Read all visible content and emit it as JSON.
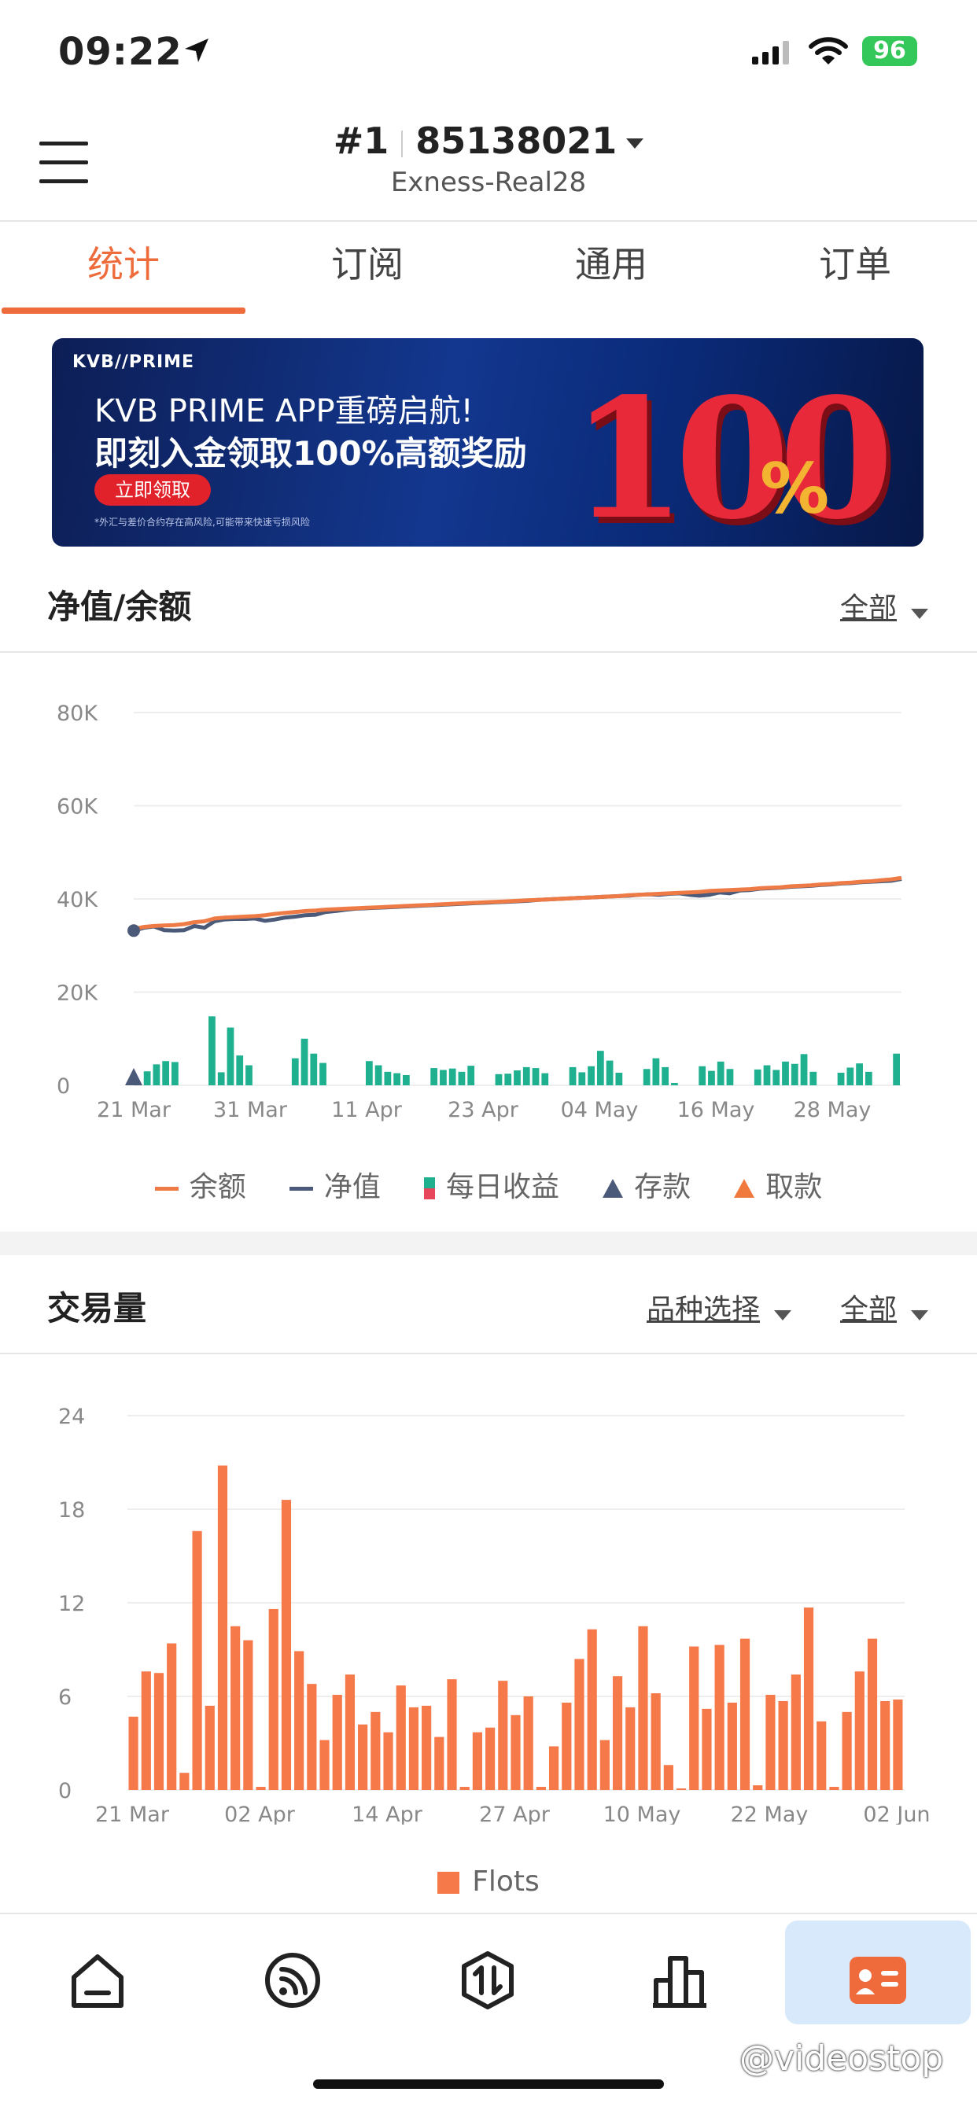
{
  "status_bar": {
    "time": "09:22",
    "battery": "96"
  },
  "header": {
    "account_prefix": "#1",
    "account_number": "85138021",
    "server": "Exness-Real28"
  },
  "tabs": [
    {
      "label": "统计",
      "active": true
    },
    {
      "label": "订阅",
      "active": false
    },
    {
      "label": "通用",
      "active": false
    },
    {
      "label": "订单",
      "active": false
    }
  ],
  "banner": {
    "brand": "KVB//PRIME",
    "line1": "KVB PRIME APP重磅启航!",
    "line2": "即刻入金领取100%高额奖励",
    "cta": "立即领取",
    "note": "*外汇与差价合约存在高风险,可能带来快速亏损风险",
    "big_number": "100",
    "percent": "%"
  },
  "equity_section": {
    "title": "净值/余额",
    "filter": "全部"
  },
  "volume_section": {
    "title": "交易量",
    "symbol_filter": "品种选择",
    "filter": "全部"
  },
  "legend_equity": [
    {
      "label": "余额",
      "color": "#ee7a45"
    },
    {
      "label": "净值",
      "color": "#4a5a78"
    },
    {
      "label": "每日收益",
      "color": "#1fb08f",
      "color2": "#e8465b"
    },
    {
      "label": "存款",
      "color": "#4a5a78"
    },
    {
      "label": "取款",
      "color": "#f07a3e"
    }
  ],
  "legend_volume": [
    {
      "label": "Flots",
      "color": "#f6794a"
    }
  ],
  "chart_data": [
    {
      "type": "line",
      "title": "净值/余额",
      "y_ticks": [
        "0",
        "20K",
        "40K",
        "60K",
        "80K"
      ],
      "ylim": [
        0,
        80000
      ],
      "x_ticks": [
        "21 Mar",
        "31 Mar",
        "11 Apr",
        "23 Apr",
        "04 May",
        "16 May",
        "28 May"
      ],
      "series": [
        {
          "name": "余额",
          "color": "#ee7a45",
          "values": [
            33500,
            34000,
            34200,
            34300,
            34400,
            34600,
            35000,
            35200,
            35800,
            36000,
            36100,
            36200,
            36300,
            36500,
            36800,
            37000,
            37200,
            37400,
            37500,
            37700,
            37800,
            37900,
            38000,
            38100,
            38200,
            38300,
            38400,
            38500,
            38600,
            38700,
            38800,
            38900,
            39000,
            39100,
            39200,
            39300,
            39400,
            39500,
            39600,
            39700,
            39800,
            39900,
            40000,
            40100,
            40200,
            40300,
            40400,
            40500,
            40600,
            40800,
            40900,
            41000,
            41100,
            41200,
            41300,
            41400,
            41500,
            41700,
            41800,
            41900,
            42000,
            42100,
            42300,
            42400,
            42500,
            42700,
            42800,
            42900,
            43100,
            43200,
            43400,
            43500,
            43700,
            43800,
            44000,
            44200,
            44500
          ]
        },
        {
          "name": "净值",
          "color": "#4a5a78",
          "values": [
            33200,
            33800,
            34100,
            33300,
            33200,
            33300,
            34200,
            33800,
            35200,
            35600,
            35700,
            35700,
            35800,
            35300,
            35600,
            36000,
            36200,
            36500,
            36600,
            37200,
            37400,
            37700,
            37900,
            38000,
            38100,
            38200,
            38300,
            38400,
            38500,
            38600,
            38700,
            38800,
            38900,
            39000,
            39100,
            39200,
            39300,
            39400,
            39500,
            39600,
            39800,
            39900,
            40000,
            40100,
            40200,
            40300,
            40400,
            40500,
            40600,
            40700,
            40900,
            41000,
            40900,
            41100,
            41200,
            40900,
            40700,
            40900,
            41400,
            41200,
            41800,
            41900,
            42200,
            42300,
            42400,
            42600,
            42700,
            42800,
            43000,
            43100,
            43300,
            43400,
            43600,
            43700,
            43800,
            43900,
            44300
          ]
        }
      ],
      "daily_profit": [
        0,
        3000,
        4500,
        5200,
        5000,
        0,
        0,
        0,
        14800,
        2800,
        12400,
        6400,
        4300,
        0,
        0,
        0,
        0,
        5800,
        10000,
        6800,
        4800,
        0,
        0,
        0,
        0,
        5200,
        4300,
        2900,
        2600,
        2200,
        0,
        0,
        3700,
        3300,
        3600,
        2900,
        4200,
        0,
        0,
        2400,
        2500,
        3200,
        3900,
        3700,
        2600,
        0,
        0,
        3900,
        2800,
        4100,
        7400,
        5300,
        2700,
        0,
        0,
        3500,
        5800,
        3900,
        500,
        0,
        0,
        4100,
        3100,
        5100,
        3500,
        0,
        0,
        3400,
        4300,
        3300,
        5100,
        4600,
        6700,
        2900,
        0,
        0,
        2700,
        3800,
        4700,
        2900,
        0,
        0,
        6800
      ],
      "deposits": [
        {
          "x": "21 Mar",
          "value": 33500
        }
      ],
      "withdrawals": []
    },
    {
      "type": "bar",
      "title": "交易量",
      "series_name": "Flots",
      "y_ticks": [
        "0",
        "6",
        "12",
        "18",
        "24"
      ],
      "ylim": [
        0,
        24
      ],
      "x_ticks": [
        "21 Mar",
        "02 Apr",
        "14 Apr",
        "27 Apr",
        "10 May",
        "22 May",
        "02 Jun"
      ],
      "values": [
        4.7,
        7.6,
        7.5,
        9.4,
        1.1,
        16.6,
        5.4,
        20.8,
        10.5,
        9.6,
        0.2,
        11.6,
        18.6,
        8.9,
        6.8,
        3.2,
        6.1,
        7.4,
        4.2,
        5.0,
        3.7,
        6.7,
        5.3,
        5.4,
        3.4,
        7.1,
        0.2,
        3.7,
        4.0,
        7.0,
        4.8,
        6.0,
        0.2,
        2.8,
        5.6,
        8.4,
        10.3,
        3.2,
        7.3,
        5.3,
        10.5,
        6.2,
        1.6,
        0.1,
        9.2,
        5.2,
        9.3,
        5.6,
        9.7,
        0.3,
        6.1,
        5.7,
        7.4,
        11.7,
        4.4,
        0.2,
        5.0,
        7.6,
        9.7,
        5.7,
        5.8
      ]
    }
  ],
  "bottom_nav": [
    {
      "name": "home",
      "active": false
    },
    {
      "name": "signal",
      "active": false
    },
    {
      "name": "trade",
      "active": false
    },
    {
      "name": "rank",
      "active": false
    },
    {
      "name": "profile",
      "active": true
    }
  ],
  "watermark": "@videostop"
}
